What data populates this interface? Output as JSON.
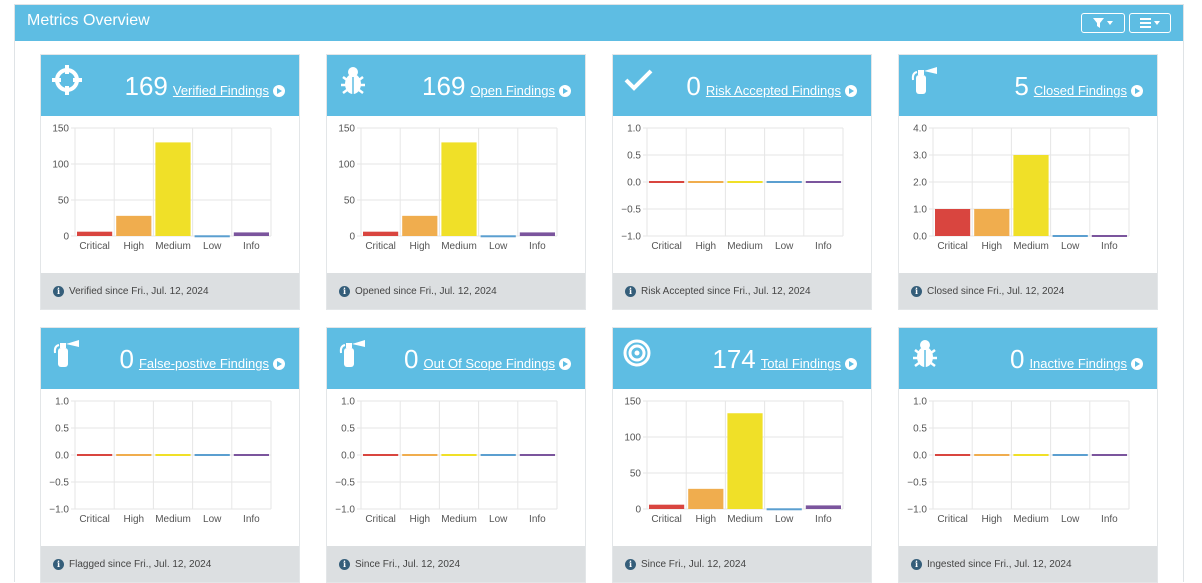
{
  "header": {
    "title": "Metrics Overview",
    "filter_icon": "filter-icon",
    "menu_icon": "menu-icon"
  },
  "colors": {
    "header_blue": "#5ebde3",
    "critical": "#d9453f",
    "high": "#f0ad4e",
    "medium": "#f0e028",
    "low": "#5b9fd0",
    "info": "#7b559d",
    "footer_bg": "#dcdfe1"
  },
  "cards": [
    {
      "icon": "crosshairs-icon",
      "count": "169",
      "label": "Verified Findings",
      "footer": "Verified since Fri., Jul. 12, 2024"
    },
    {
      "icon": "bug-icon",
      "count": "169",
      "label": "Open Findings",
      "footer": "Opened since Fri., Jul. 12, 2024"
    },
    {
      "icon": "check-icon",
      "count": "0",
      "label": "Risk Accepted Findings",
      "footer": "Risk Accepted since Fri., Jul. 12, 2024"
    },
    {
      "icon": "fire-extinguisher-icon",
      "count": "5",
      "label": "Closed Findings",
      "footer": "Closed since Fri., Jul. 12, 2024"
    },
    {
      "icon": "fire-extinguisher-icon",
      "count": "0",
      "label": "False-postive Findings",
      "footer": "Flagged since Fri., Jul. 12, 2024"
    },
    {
      "icon": "fire-extinguisher-icon",
      "count": "0",
      "label": "Out Of Scope Findings",
      "footer": "Since Fri., Jul. 12, 2024"
    },
    {
      "icon": "bullseye-icon",
      "count": "174",
      "label": "Total Findings",
      "footer": "Since Fri., Jul. 12, 2024"
    },
    {
      "icon": "bug-icon",
      "count": "0",
      "label": "Inactive Findings",
      "footer": "Ingested since Fri., Jul. 12, 2024"
    }
  ],
  "chart_data": [
    {
      "type": "bar",
      "categories": [
        "Critical",
        "High",
        "Medium",
        "Low",
        "Info"
      ],
      "values": [
        6,
        28,
        130,
        1,
        5
      ],
      "ylim": [
        0,
        150
      ],
      "yticks": [
        0,
        50,
        100,
        150
      ],
      "ytick_labels": [
        "0",
        "50",
        "100",
        "150"
      ]
    },
    {
      "type": "bar",
      "categories": [
        "Critical",
        "High",
        "Medium",
        "Low",
        "Info"
      ],
      "values": [
        6,
        28,
        130,
        1,
        5
      ],
      "ylim": [
        0,
        150
      ],
      "yticks": [
        0,
        50,
        100,
        150
      ],
      "ytick_labels": [
        "0",
        "50",
        "100",
        "150"
      ]
    },
    {
      "type": "bar",
      "categories": [
        "Critical",
        "High",
        "Medium",
        "Low",
        "Info"
      ],
      "values": [
        0,
        0,
        0,
        0,
        0
      ],
      "ylim": [
        -1,
        1
      ],
      "yticks": [
        1,
        0.5,
        0,
        -0.5,
        -1
      ],
      "ytick_labels": [
        "1.0",
        "0.5",
        "0.0",
        "−0.5",
        "−1.0"
      ]
    },
    {
      "type": "bar",
      "categories": [
        "Critical",
        "High",
        "Medium",
        "Low",
        "Info"
      ],
      "values": [
        1,
        1,
        3,
        0,
        0
      ],
      "ylim": [
        0,
        4
      ],
      "yticks": [
        4,
        3,
        2,
        1,
        0
      ],
      "ytick_labels": [
        "4.0",
        "3.0",
        "2.0",
        "1.0",
        "0.0"
      ]
    },
    {
      "type": "bar",
      "categories": [
        "Critical",
        "High",
        "Medium",
        "Low",
        "Info"
      ],
      "values": [
        0,
        0,
        0,
        0,
        0
      ],
      "ylim": [
        -1,
        1
      ],
      "yticks": [
        1,
        0.5,
        0,
        -0.5,
        -1
      ],
      "ytick_labels": [
        "1.0",
        "0.5",
        "0.0",
        "−0.5",
        "−1.0"
      ]
    },
    {
      "type": "bar",
      "categories": [
        "Critical",
        "High",
        "Medium",
        "Low",
        "Info"
      ],
      "values": [
        0,
        0,
        0,
        0,
        0
      ],
      "ylim": [
        -1,
        1
      ],
      "yticks": [
        1,
        0.5,
        0,
        -0.5,
        -1
      ],
      "ytick_labels": [
        "1.0",
        "0.5",
        "0.0",
        "−0.5",
        "−1.0"
      ]
    },
    {
      "type": "bar",
      "categories": [
        "Critical",
        "High",
        "Medium",
        "Low",
        "Info"
      ],
      "values": [
        6,
        28,
        133,
        1,
        5
      ],
      "ylim": [
        0,
        150
      ],
      "yticks": [
        0,
        50,
        100,
        150
      ],
      "ytick_labels": [
        "0",
        "50",
        "100",
        "150"
      ]
    },
    {
      "type": "bar",
      "categories": [
        "Critical",
        "High",
        "Medium",
        "Low",
        "Info"
      ],
      "values": [
        0,
        0,
        0,
        0,
        0
      ],
      "ylim": [
        -1,
        1
      ],
      "yticks": [
        1,
        0.5,
        0,
        -0.5,
        -1
      ],
      "ytick_labels": [
        "1.0",
        "0.5",
        "0.0",
        "−0.5",
        "−1.0"
      ]
    }
  ]
}
